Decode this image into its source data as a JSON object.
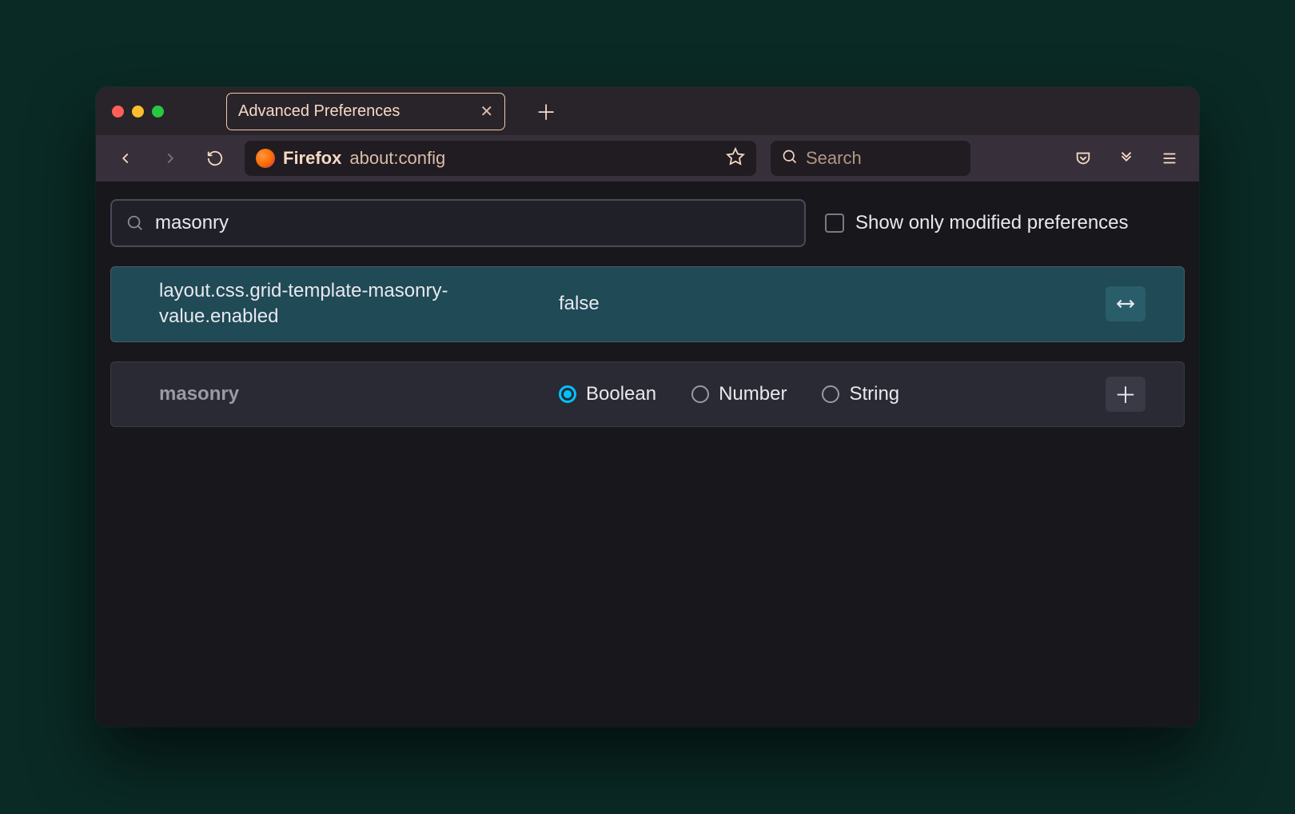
{
  "window": {
    "tab_title": "Advanced Preferences"
  },
  "toolbar": {
    "url_label": "Firefox",
    "url_value": "about:config",
    "search_placeholder": "Search"
  },
  "config": {
    "search_value": "masonry",
    "checkbox_label": "Show only modified preferences",
    "checkbox_checked": false,
    "result": {
      "name": "layout.css.grid-template-masonry-value.enabled",
      "value": "false"
    },
    "new_pref": {
      "name": "masonry",
      "types": [
        "Boolean",
        "Number",
        "String"
      ],
      "selected": "Boolean"
    }
  }
}
